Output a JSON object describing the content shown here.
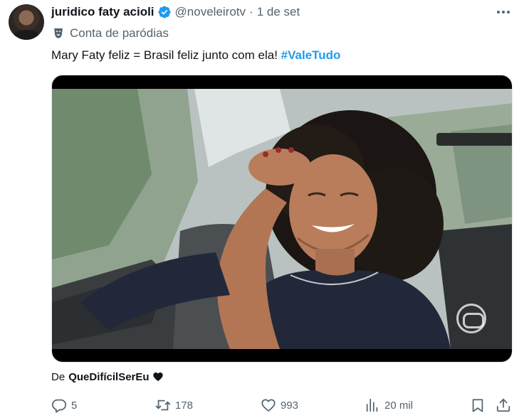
{
  "tweet": {
    "author_name": "juridico faty acioli",
    "handle": "@noveleirotv",
    "separator": "·",
    "time": "1 de set",
    "parody_label": "Conta de paródias",
    "text_before": "Mary Faty feliz = Brasil feliz junto com ela!",
    "hashtag": "#ValeTudo",
    "source_prefix": "De",
    "source_name": "QueDifícilSerEu"
  },
  "actions": {
    "replies": "5",
    "retweets": "178",
    "likes": "993",
    "views": "20 mil"
  },
  "colors": {
    "accent": "#1d9bf0",
    "text": "#0f1419",
    "muted": "#536471"
  },
  "icons": [
    "verified-badge-icon",
    "more-icon",
    "parody-mask-icon",
    "heart-emoji-icon",
    "reply-icon",
    "retweet-icon",
    "like-icon",
    "views-icon",
    "bookmark-icon",
    "share-icon"
  ]
}
